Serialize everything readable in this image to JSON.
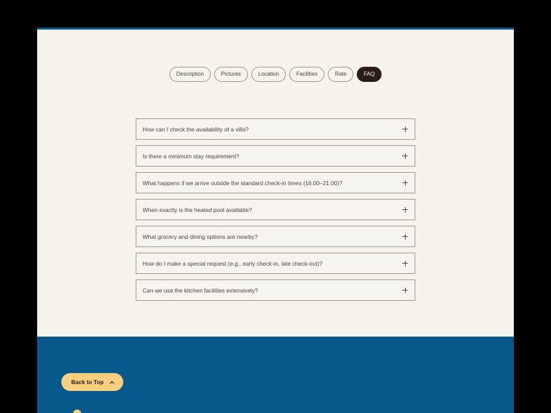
{
  "tabs": [
    {
      "label": "Description",
      "active": false
    },
    {
      "label": "Pictures",
      "active": false
    },
    {
      "label": "Location",
      "active": false
    },
    {
      "label": "Facilities",
      "active": false
    },
    {
      "label": "Rate",
      "active": false
    },
    {
      "label": "FAQ",
      "active": true
    }
  ],
  "faq": [
    {
      "question": "How can I check the availability of a villa?"
    },
    {
      "question": "Is there a minimum stay requirement?"
    },
    {
      "question": "What happens if we arrive outside the standard check-in times (16:00–21:00)?"
    },
    {
      "question": "When exactly is the heated pool available?"
    },
    {
      "question": "What grocery and dining options are nearby?"
    },
    {
      "question": "How do I make a special request (e.g., early check-in, late check-out)?"
    },
    {
      "question": "Can we use the kitchen facilities extensively?"
    }
  ],
  "footer": {
    "back_to_top_label": "Back to Top"
  },
  "colors": {
    "page_bg": "#f5f3ec",
    "footer_bg": "#06598a",
    "accent": "#f7cf7e",
    "active_tab": "#2b1c17"
  }
}
